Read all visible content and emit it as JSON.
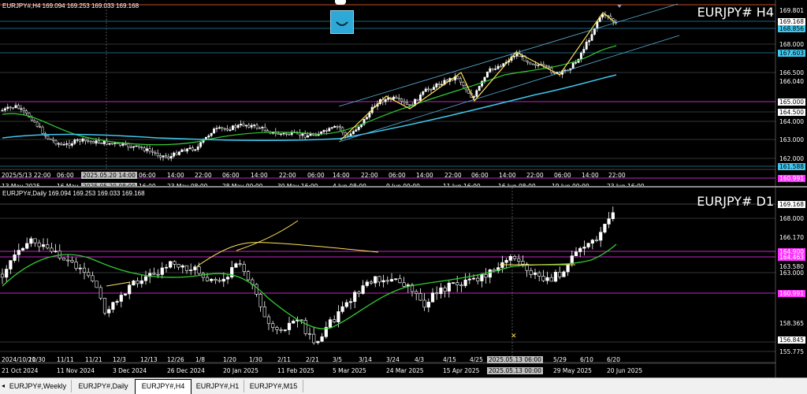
{
  "colors": {
    "background": "#000000",
    "candles": "#ffffff",
    "ma_green": "#33cc33",
    "ma_cyan": "#3fc6ee",
    "channel": "#5ab4dc",
    "magenta": "#ff33ff",
    "zigzag": "#ffe25a"
  },
  "h4": {
    "header": "EURJPY#,H4  169.094 169.253 169.033 169.168",
    "big_title": "EURJPY# H4",
    "price_labels": [
      "169.801",
      "169.168",
      "168.856",
      "168.000",
      "167.603",
      "166.500",
      "166.040",
      "165.000",
      "164.500",
      "164.000",
      "163.000",
      "162.000",
      "161.588",
      "160.991"
    ],
    "time_labels": [
      "2025/5/13 22:00",
      "06:00",
      "2025.05.20 14:00",
      "06:00",
      "14:00",
      "22:00",
      "06:00",
      "14:00",
      "22:00",
      "06:00",
      "14:00",
      "22:00",
      "06:00",
      "14:00",
      "22:00",
      "06:00",
      "14:00",
      "22:00",
      "06:00",
      "14:00",
      "22:00"
    ],
    "date_labels": [
      "13 May 2025",
      "16 May",
      "2025.05.20 08:00",
      "16:00",
      "23 May 08:00",
      "28 May 00:00",
      "30 May 16:00",
      "4 Jun 08:00",
      "9 Jun 00:00",
      "11 Jun 16:00",
      "16 Jun 08:00",
      "19 Jun 00:00",
      "23 Jun 16:00"
    ]
  },
  "d1": {
    "header": "EURJPY#,Daily  169.094 169.253 169.033 169.168",
    "big_title": "EURJPY# D1",
    "price_labels": [
      "169.168",
      "168.000",
      "166.170",
      "164.900",
      "164.463",
      "163.580",
      "163.000",
      "160.991",
      "158.365",
      "156.845",
      "155.775"
    ],
    "time_labels": [
      "2024/10/21",
      "10/30",
      "11/11",
      "11/21",
      "12/3",
      "12/13",
      "12/26",
      "1/8",
      "1/20",
      "1/30",
      "2/11",
      "2/21",
      "3/5",
      "3/14",
      "3/24",
      "4/3",
      "4/15",
      "4/25",
      "2025.05.13 06:00",
      "5/29",
      "6/10",
      "6/20"
    ],
    "date_labels": [
      "21 Oct 2024",
      "11 Nov 2024",
      "3 Dec 2024",
      "26 Dec 2024",
      "20 Jan 2025",
      "11 Feb 2025",
      "5 Mar 2025",
      "24 Mar 2025",
      "15 Apr 2025",
      "2025.05.13 00:00",
      "29 May 2025",
      "20 Jun 2025"
    ]
  },
  "tabs": [
    {
      "label": "EURJPY#,Weekly"
    },
    {
      "label": "EURJPY#,Daily"
    },
    {
      "label": "EURJPY#,H4"
    },
    {
      "label": "EURJPY#,H1"
    },
    {
      "label": "EURJPY#,M15"
    }
  ],
  "widget_icon": "smile-icon",
  "scroll_icon": "chevron-left-icon"
}
